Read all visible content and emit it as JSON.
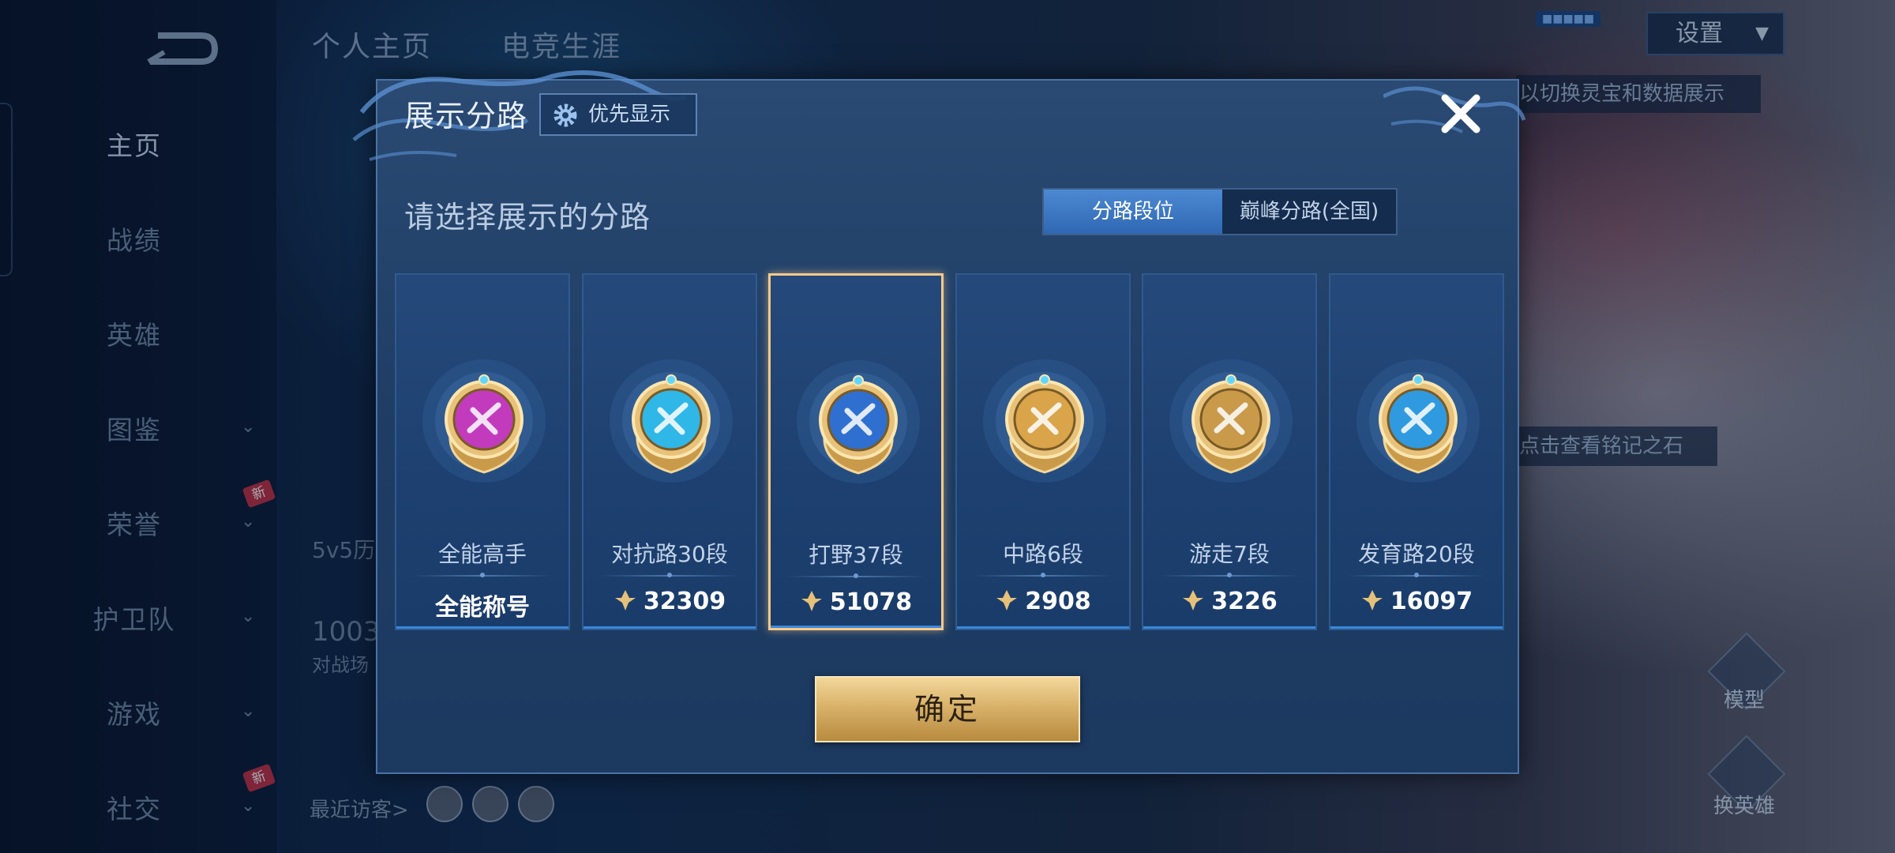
{
  "nav": {
    "items": [
      {
        "label": "主页",
        "active": true
      },
      {
        "label": "战绩"
      },
      {
        "label": "英雄"
      },
      {
        "label": "图鉴"
      },
      {
        "label": "荣誉"
      },
      {
        "label": "护卫队"
      },
      {
        "label": "游戏"
      },
      {
        "label": "社交"
      }
    ],
    "new_badge": "新"
  },
  "background": {
    "tab_profile": "个人主页",
    "tab_esports": "电竞生涯",
    "settings_label": "设置",
    "hint_top": "以切换灵宝和数据展示",
    "hint_mid": "点击查看铭记之石",
    "action_label": "模型",
    "swap_hero_label": "换英雄",
    "recent_visitors": "最近访客>",
    "bg_text_1": "5v5历",
    "bg_text_2": "1003",
    "bg_text_3": "对战场"
  },
  "modal": {
    "title": "展示分路",
    "priority_label": "优先显示",
    "subtitle": "请选择展示的分路",
    "segment": {
      "active": "分路段位",
      "inactive": "巅峰分路(全国)"
    },
    "cards": [
      {
        "label": "全能高手",
        "value": "全能称号",
        "badge": "all-round-badge",
        "color": "#c23bbd",
        "selected": false,
        "has_points": false
      },
      {
        "label": "对抗路30段",
        "value": "32309",
        "badge": "clash-lane-badge",
        "color": "#2fb7e8",
        "selected": false,
        "has_points": true
      },
      {
        "label": "打野37段",
        "value": "51078",
        "badge": "jungle-badge",
        "color": "#2f6fd0",
        "selected": true,
        "has_points": true
      },
      {
        "label": "中路6段",
        "value": "2908",
        "badge": "mid-lane-badge",
        "color": "#d9a44a",
        "selected": false,
        "has_points": true
      },
      {
        "label": "游走7段",
        "value": "3226",
        "badge": "roam-badge",
        "color": "#c99a4a",
        "selected": false,
        "has_points": true
      },
      {
        "label": "发育路20段",
        "value": "16097",
        "badge": "farm-lane-badge",
        "color": "#2f9ae0",
        "selected": false,
        "has_points": true
      }
    ],
    "confirm_label": "确定"
  },
  "colors": {
    "accent_gold": "#f6c98b",
    "accent_blue": "#3b87d9"
  }
}
